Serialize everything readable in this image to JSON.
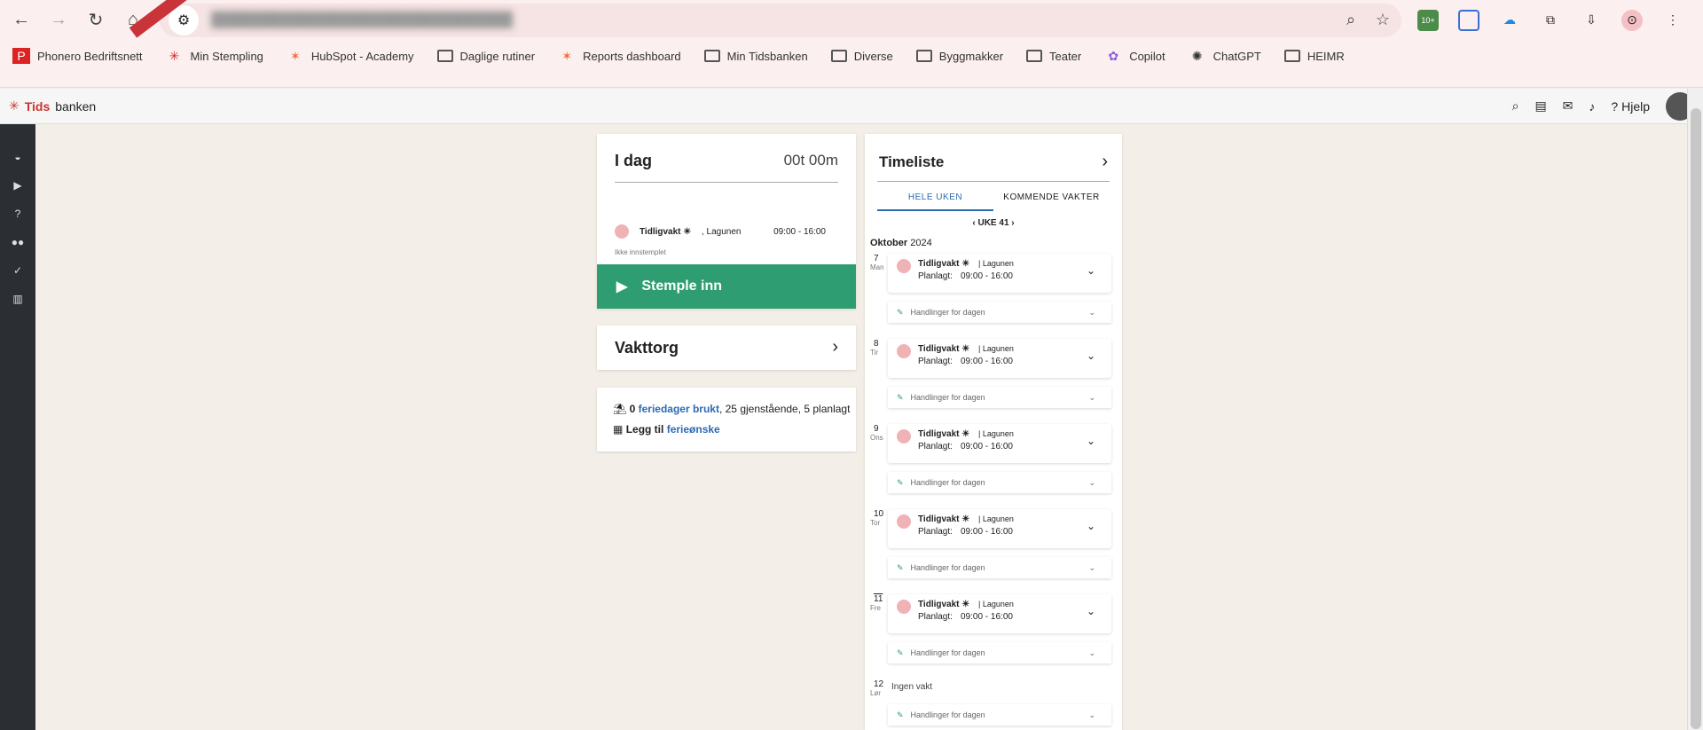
{
  "bookmarks": [
    "Phonero Bedriftsnett",
    "Min Stempling",
    "HubSpot - Academy",
    "Daglige rutiner",
    "Reports dashboard",
    "Min Tidsbanken",
    "Diverse",
    "Byggmakker",
    "Teater",
    "Copilot",
    "ChatGPT",
    "HEIMR"
  ],
  "app": {
    "logo_prefix": "Tids",
    "logo_suffix": "banken",
    "help": "Hjelp"
  },
  "today": {
    "title": "I dag",
    "total": "00t 00m",
    "shift_name": "Tidligvakt",
    "location": ", Lagunen",
    "time": "09:00 - 16:00",
    "status": "Ikke innstemplet",
    "button": "Stemple inn"
  },
  "vakttorg": {
    "title": "Vakttorg"
  },
  "vacation": {
    "used": "0",
    "used_label": "feriedager brukt",
    "rest": ", 25 gjenstående, 5 planlagt",
    "add_prefix": "Legg til",
    "add_link": "ferieønske"
  },
  "timeliste": {
    "title": "Timeliste",
    "tab_all": "HELE UKEN",
    "tab_upcoming": "KOMMENDE VAKTER",
    "week": "UKE 41",
    "month": "Oktober",
    "year": "2024",
    "days": [
      {
        "num": "7",
        "dow": "Man",
        "shift": "Tidligvakt",
        "loc": "| Lagunen",
        "planned": "Planlagt:",
        "time": "09:00 - 16:00",
        "actions": "Handlinger for dagen"
      },
      {
        "num": "8",
        "dow": "Tir",
        "shift": "Tidligvakt",
        "loc": "| Lagunen",
        "planned": "Planlagt:",
        "time": "09:00 - 16:00",
        "actions": "Handlinger for dagen"
      },
      {
        "num": "9",
        "dow": "Ons",
        "shift": "Tidligvakt",
        "loc": "| Lagunen",
        "planned": "Planlagt:",
        "time": "09:00 - 16:00",
        "actions": "Handlinger for dagen"
      },
      {
        "num": "10",
        "dow": "Tor",
        "shift": "Tidligvakt",
        "loc": "| Lagunen",
        "planned": "Planlagt:",
        "time": "09:00 - 16:00",
        "actions": "Handlinger for dagen"
      },
      {
        "num": "11",
        "dow": "Fre",
        "shift": "Tidligvakt",
        "loc": "| Lagunen",
        "planned": "Planlagt:",
        "time": "09:00 - 16:00",
        "actions": "Handlinger for dagen"
      }
    ],
    "last_day": {
      "num": "12",
      "dow": "Lør",
      "text": "Ingen vakt",
      "actions": "Handlinger for dagen"
    }
  }
}
